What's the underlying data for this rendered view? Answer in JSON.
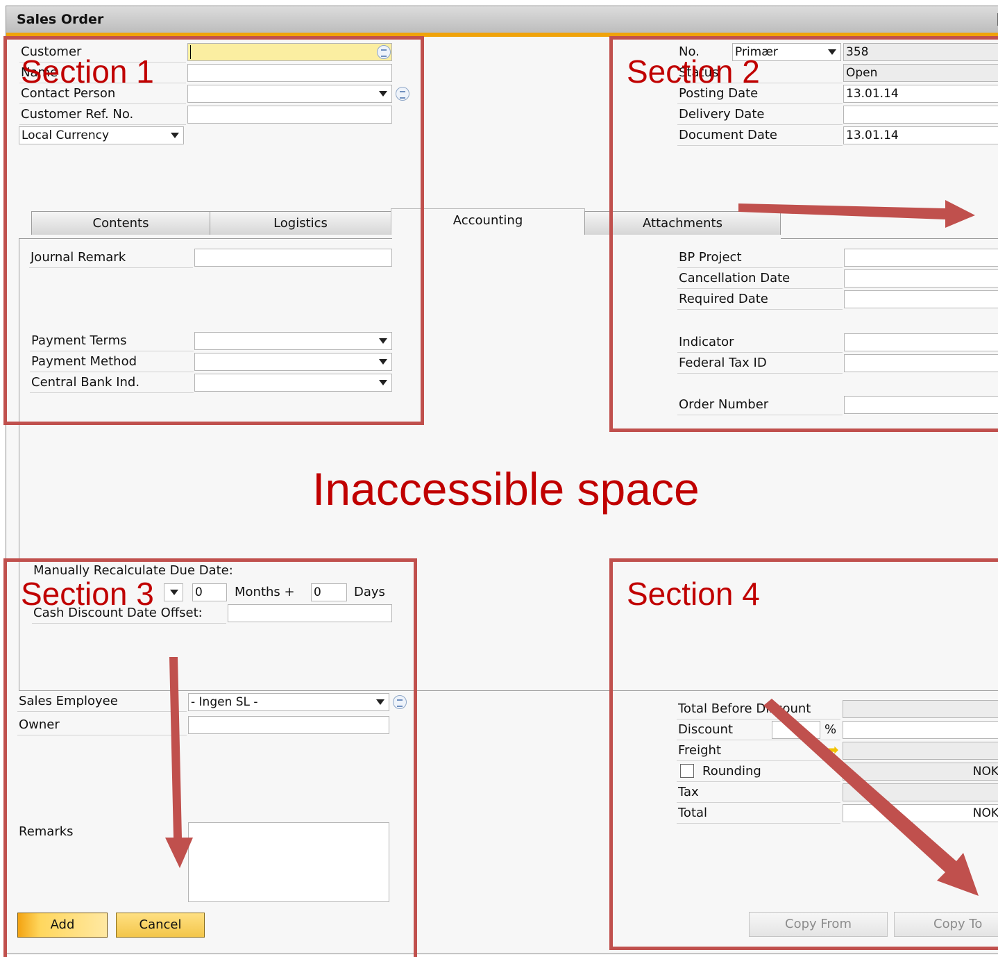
{
  "window": {
    "title": "Sales Order"
  },
  "header_left": {
    "customer_label": "Customer",
    "name_label": "Name",
    "contact_person_label": "Contact Person",
    "customer_ref_label": "Customer Ref. No.",
    "currency_value": "Local Currency"
  },
  "header_right": {
    "no_label": "No.",
    "series_value": "Primær",
    "no_value": "358",
    "status_label": "Status",
    "status_value": "Open",
    "posting_date_label": "Posting Date",
    "posting_date_value": "13.01.14",
    "delivery_date_label": "Delivery Date",
    "document_date_label": "Document Date",
    "document_date_value": "13.01.14"
  },
  "tabs": [
    {
      "label": "Contents"
    },
    {
      "label": "Logistics"
    },
    {
      "label": "Accounting"
    },
    {
      "label": "Attachments"
    }
  ],
  "accounting": {
    "journal_remark_label": "Journal Remark",
    "payment_terms_label": "Payment Terms",
    "payment_method_label": "Payment Method",
    "central_bank_label": "Central Bank Ind.",
    "bp_project_label": "BP Project",
    "cancellation_date_label": "Cancellation Date",
    "required_date_label": "Required Date",
    "indicator_label": "Indicator",
    "federal_tax_label": "Federal Tax ID",
    "order_number_label": "Order Number",
    "recalc_label": "Manually Recalculate Due Date:",
    "months_value": "0",
    "months_label": "Months +",
    "days_value": "0",
    "days_label": "Days",
    "cash_discount_label": "Cash Discount Date Offset:"
  },
  "footer_left": {
    "sales_employee_label": "Sales Employee",
    "sales_employee_value": "- Ingen SL -",
    "owner_label": "Owner",
    "remarks_label": "Remarks"
  },
  "totals": {
    "total_before_discount_label": "Total Before Discount",
    "discount_label": "Discount",
    "percent_symbol": "%",
    "freight_label": "Freight",
    "rounding_label": "Rounding",
    "rounding_currency": "NOK",
    "tax_label": "Tax",
    "total_label": "Total",
    "total_currency": "NOK"
  },
  "buttons": {
    "add": "Add",
    "cancel": "Cancel",
    "copy_from": "Copy From",
    "copy_to": "Copy To"
  },
  "annotations": {
    "section1": "Section 1",
    "section2": "Section 2",
    "section3": "Section 3",
    "section4": "Section 4",
    "inaccessible": "Inaccessible space",
    "color": "#c0504d"
  }
}
